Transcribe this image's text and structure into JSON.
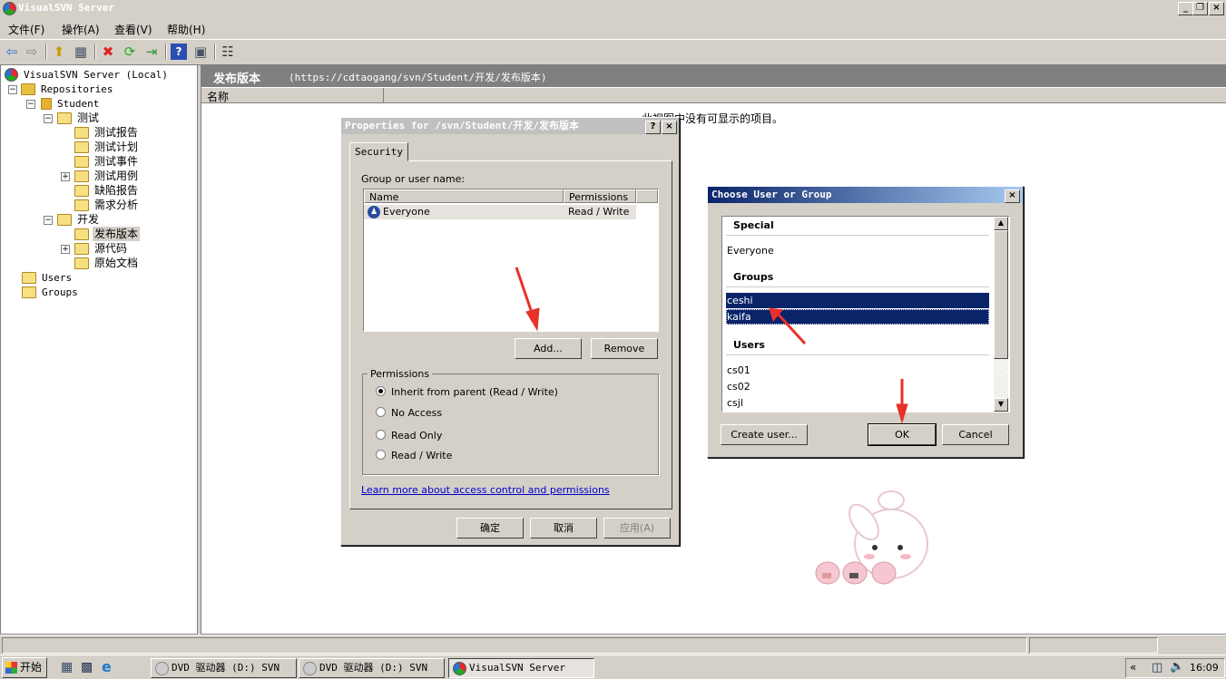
{
  "window": {
    "title": "VisualSVN Server",
    "controls": [
      "_",
      "❐",
      "×"
    ]
  },
  "menu": [
    {
      "label": "文件(F)"
    },
    {
      "label": "操作(A)"
    },
    {
      "label": "查看(V)"
    },
    {
      "label": "帮助(H)"
    }
  ],
  "tree": {
    "root": "VisualSVN Server (Local)",
    "repositories": "Repositories",
    "student": "Student",
    "ceshi": "测试",
    "ceshi_items": [
      "测试报告",
      "测试计划",
      "测试事件",
      "测试用例",
      "缺陷报告",
      "需求分析"
    ],
    "kaifa": "开发",
    "kaifa_items": [
      "发布版本",
      "源代码",
      "原始文档"
    ],
    "users": "Users",
    "groups": "Groups"
  },
  "right": {
    "title": "发布版本",
    "url": "(https://cdtaogang/svn/Student/开发/发布版本)",
    "column": "名称",
    "empty_message": "此视图中没有可显示的项目。"
  },
  "properties": {
    "title": "Properties for /svn/Student/开发/发布版本",
    "tab": "Security",
    "group_label": "Group or user name:",
    "col_name": "Name",
    "col_perm": "Permissions",
    "entries": [
      {
        "name": "Everyone",
        "perm": "Read / Write"
      }
    ],
    "add": "Add...",
    "remove": "Remove",
    "perm_group": "Permissions",
    "options": [
      {
        "label": "Inherit from parent (Read / Write)",
        "checked": true
      },
      {
        "label": "No Access",
        "checked": false
      },
      {
        "label": "Read Only",
        "checked": false
      },
      {
        "label": "Read / Write",
        "checked": false
      }
    ],
    "link": "Learn more about access control and permissions",
    "ok": "确定",
    "cancel": "取消",
    "apply": "应用(A)"
  },
  "choose": {
    "title": "Choose User or Group",
    "special_header": "Special",
    "special": [
      "Everyone"
    ],
    "groups_header": "Groups",
    "groups": [
      {
        "name": "ceshi",
        "selected": true
      },
      {
        "name": "kaifa",
        "selected": true
      }
    ],
    "users_header": "Users",
    "users": [
      "cs01",
      "cs02",
      "csjl"
    ],
    "create_user": "Create user...",
    "ok": "OK",
    "cancel": "Cancel"
  },
  "taskbar": {
    "start": "开始",
    "tasks": [
      "DVD 驱动器 (D:) SVN",
      "DVD 驱动器 (D:) SVN",
      "VisualSVN Server"
    ],
    "clock": "16:09",
    "chevron": "«"
  },
  "colors": {
    "accent": "#0a246a",
    "arrow": "#e8312a"
  },
  "icons": [
    "back-icon",
    "forward-icon",
    "up-icon",
    "view-icon",
    "delete-icon",
    "refresh-icon",
    "export-icon",
    "help-icon",
    "panel-icon",
    "properties-icon"
  ]
}
